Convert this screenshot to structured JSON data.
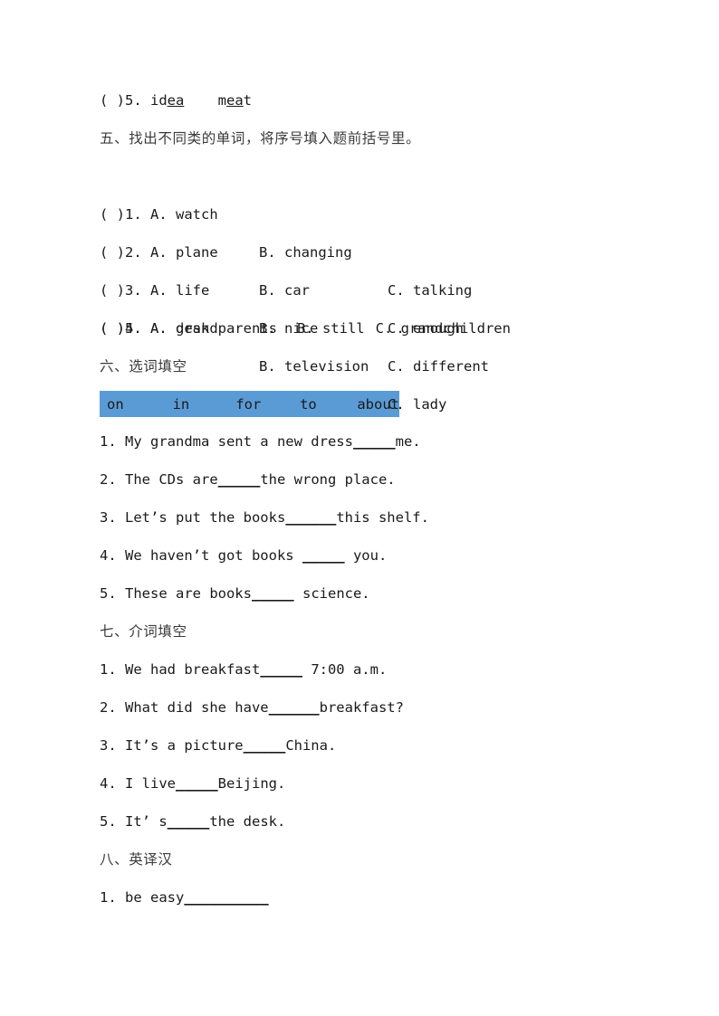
{
  "document": {
    "page_background": "#ffffff",
    "accent_color": "#5b9bd5",
    "text_color": "#1a1a1a"
  },
  "top_item": {
    "prefix": "( )5. id",
    "underline_1": "ea",
    "gap": "    m",
    "underline_2": "ea",
    "suffix": "t"
  },
  "section_five": {
    "heading": "五、找出不同类的单词，将序号填入题前括号里。",
    "items": [
      {
        "a": "( )1. A. watch",
        "b": "B. changing",
        "c": "C. talking",
        "layout": "columns"
      },
      {
        "a": "( )2. A. plane",
        "b": "B. car",
        "c": "C. enough",
        "layout": "columns"
      },
      {
        "a": "( )3. A. life",
        "b": "B. nice",
        "c": "C. different",
        "layout": "columns"
      },
      {
        "a": "( )4. A. desk",
        "b": "B. television",
        "c": "C. lady",
        "layout": "columns4"
      },
      {
        "a": "( )5. A. grandparents",
        "b": "B. still",
        "c": "C. grandchildren",
        "layout": "flow"
      }
    ]
  },
  "section_six": {
    "heading": "六、选词填空",
    "word_bank": [
      "on",
      "in",
      "for",
      "to",
      "about"
    ],
    "questions": [
      {
        "before": "1. My grandma sent a new dress",
        "blank": "_____",
        "after": "me."
      },
      {
        "before": "2. The CDs are",
        "blank": "_____",
        "after": "the wrong place."
      },
      {
        "before": "3. Let’s put the books",
        "blank": "______",
        "after": "this shelf."
      },
      {
        "before": "4. We haven’t got books ",
        "blank": "_____",
        "after": " you."
      },
      {
        "before": "5. These are books",
        "blank": "_____",
        "after": " science."
      }
    ]
  },
  "section_seven": {
    "heading": "七、介词填空",
    "questions": [
      {
        "before": "1. We had breakfast",
        "blank": "_____",
        "after": " 7:00 a.m."
      },
      {
        "before": "2. What did she have",
        "blank": "______",
        "after": "breakfast?"
      },
      {
        "before": "3. It’s a picture",
        "blank": "_____",
        "after": "China."
      },
      {
        "before": "4. I live",
        "blank": "_____",
        "after": "Beijing."
      },
      {
        "before": "5. It’ s",
        "blank": "_____",
        "after": "the desk."
      }
    ]
  },
  "section_eight": {
    "heading": "八、英译汉",
    "questions": [
      {
        "before": "1. be easy",
        "blank": "__________",
        "after": ""
      }
    ]
  }
}
